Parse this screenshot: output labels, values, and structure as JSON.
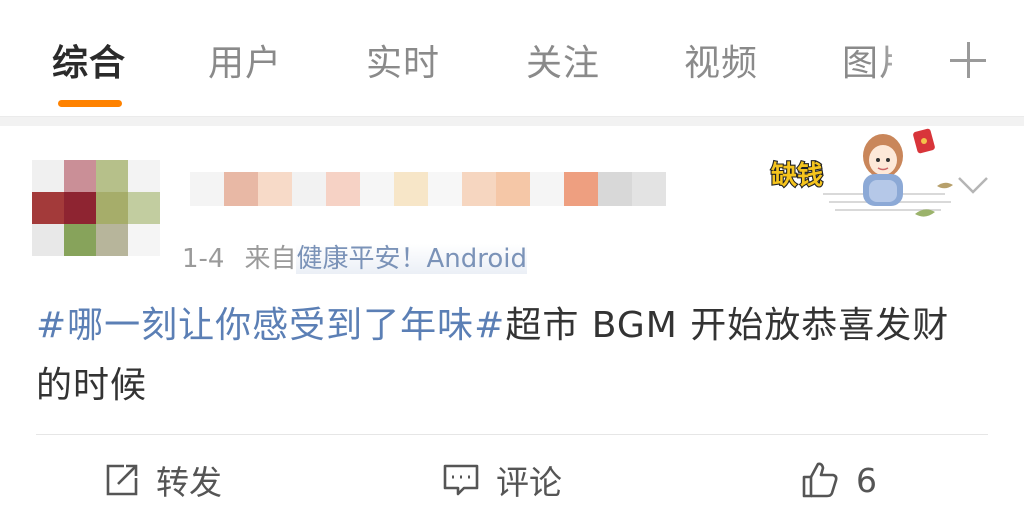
{
  "tabs": [
    {
      "label": "综合",
      "active": true
    },
    {
      "label": "用户",
      "active": false
    },
    {
      "label": "实时",
      "active": false
    },
    {
      "label": "关注",
      "active": false
    },
    {
      "label": "视频",
      "active": false
    },
    {
      "label": "图片",
      "active": false
    }
  ],
  "accent_color": "#ff8200",
  "link_color": "#5b7fb5",
  "post": {
    "time": "1-4",
    "source_prefix": "来自",
    "source_name": "健康平安！Android",
    "badge_text": "缺钱",
    "hashtag": "#哪一刻让你感受到了年味#",
    "body": "超市 BGM 开始放恭喜发财的时候"
  },
  "actions": {
    "repost_label": "转发",
    "comment_label": "评论",
    "like_count": "6"
  }
}
